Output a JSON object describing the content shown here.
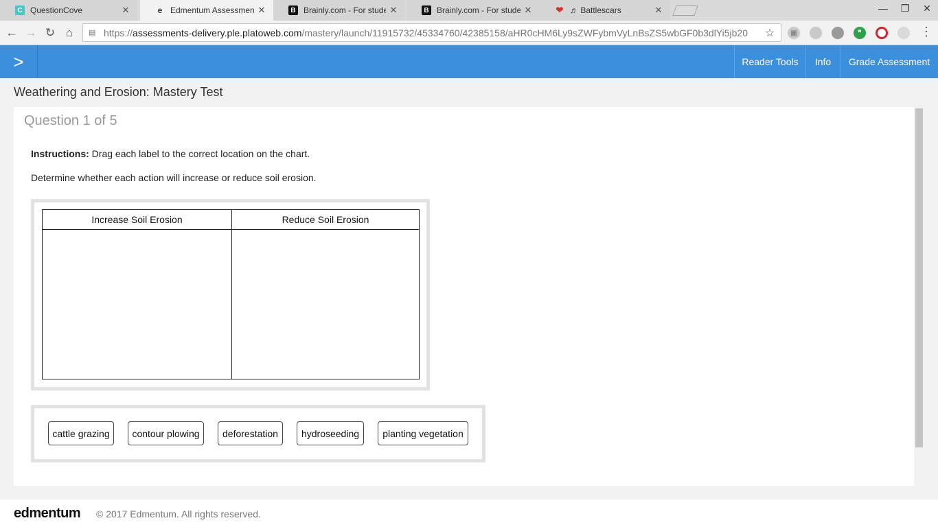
{
  "browser": {
    "tabs": [
      {
        "title": "QuestionCove",
        "favicon": "questioncove-icon",
        "active": false
      },
      {
        "title": "Edmentum Assessments",
        "favicon": "edmentum-icon",
        "active": true
      },
      {
        "title": "Brainly.com - For students",
        "favicon": "brainly-icon",
        "active": false
      },
      {
        "title": "Brainly.com - For students",
        "favicon": "brainly-icon",
        "active": false
      },
      {
        "title": "♬ Battlescars",
        "favicon": "iheartradio-icon",
        "active": false
      }
    ],
    "url_scheme": "https://",
    "url_host": "assessments-delivery.ple.platoweb.com",
    "url_path": "/mastery/launch/11915732/45334760/42385158/aHR0cHM6Ly9sZWFybmVyLnBsZS5wbGF0b3dlYi5jb20"
  },
  "appbar": {
    "links": [
      "Reader Tools",
      "Info",
      "Grade Assessment"
    ]
  },
  "test_title": "Weathering and Erosion: Mastery Test",
  "question": {
    "number_label": "Question 1 of 5",
    "instructions_label": "Instructions:",
    "instructions_text": " Drag each label to the correct location on the chart.",
    "prompt": "Determine whether each action will increase or reduce soil erosion."
  },
  "chart": {
    "columns": [
      "Increase Soil Erosion",
      "Reduce Soil Erosion"
    ]
  },
  "labels": [
    "cattle grazing",
    "contour plowing",
    "deforestation",
    "hydroseeding",
    "planting vegetation"
  ],
  "footer": {
    "logo": "edmentum",
    "copyright": "© 2017 Edmentum. All rights reserved."
  },
  "colors": {
    "appbar": "#3b8fdd",
    "page_bg": "#f2f2f2"
  }
}
